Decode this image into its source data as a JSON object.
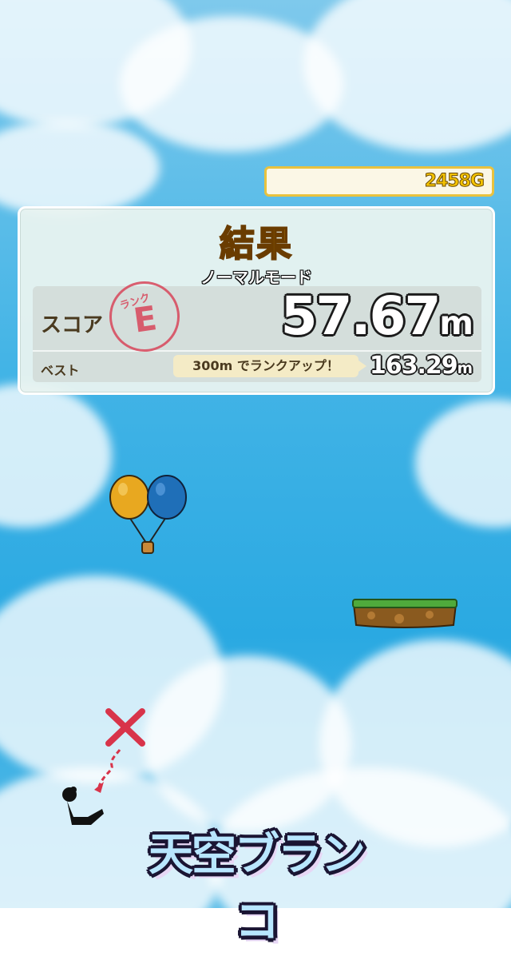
{
  "hud": {
    "gold": "2458G"
  },
  "result_panel": {
    "title": "結果",
    "mode": "ノーマルモード",
    "score_label": "スコア",
    "rank_stamp_label": "ランク",
    "rank": "E",
    "score_value": "57.67",
    "score_unit": "m",
    "best_label": "ベスト",
    "rank_up_hint": "300m でランクアップ！",
    "best_value": "163.29",
    "best_unit": "m"
  },
  "logo_text": "天空ブランコ",
  "colors": {
    "sky": "#2aa9e2",
    "gold_border": "#e9c23e",
    "gold_text": "#f4c300",
    "title": "#f0b41c",
    "stamp": "#d8465a",
    "balloon_left": "#e8a820",
    "balloon_right": "#1f6fb8",
    "platform_grass": "#4faa3c",
    "platform_dirt": "#8a5a1f",
    "x_mark": "#d8344a"
  },
  "icons": [
    "balloon-icon",
    "platform-icon",
    "x-mark-icon",
    "player-silhouette-icon"
  ]
}
